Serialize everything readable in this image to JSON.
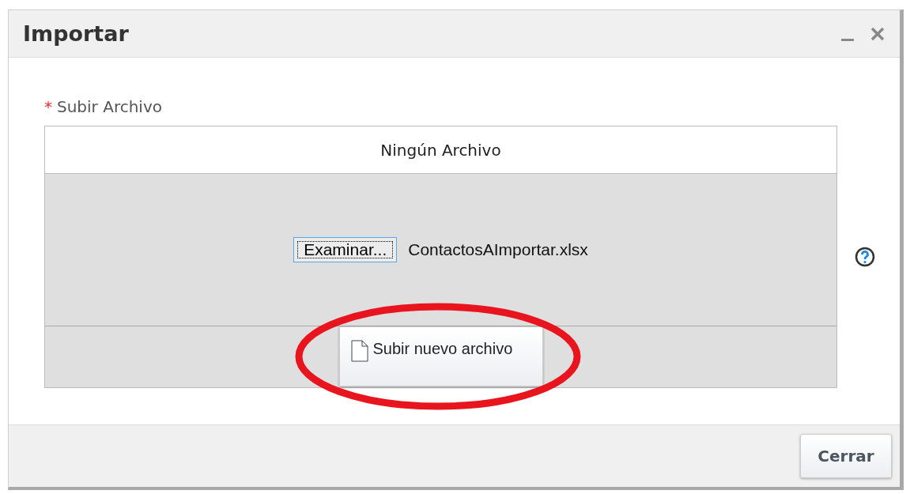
{
  "window": {
    "title": "Importar"
  },
  "field": {
    "required_mark": "*",
    "label": "Subir Archivo",
    "status": "Ningún Archivo",
    "browse_button": "Examinar...",
    "file_name": "ContactosAImportar.xlsx",
    "upload_button": "Subir nuevo archivo"
  },
  "buttons": [
    "Cerrar"
  ]
}
